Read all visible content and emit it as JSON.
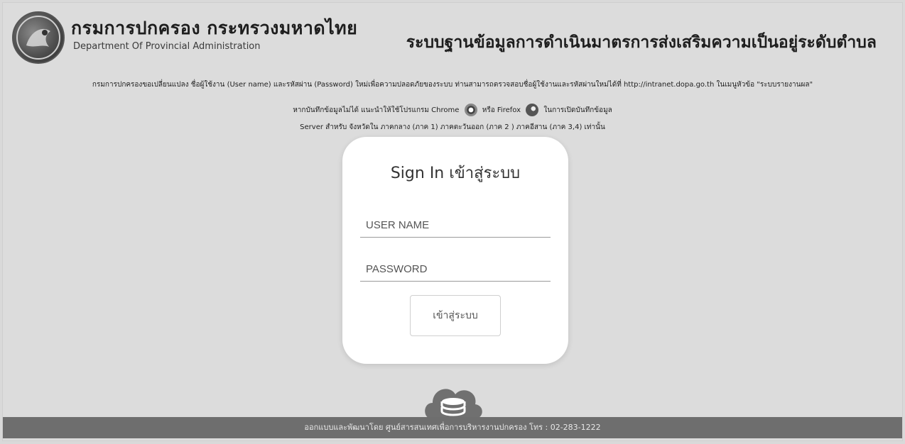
{
  "header": {
    "org_name_th": "กรมการปกครอง กระทรวงมหาดไทย",
    "org_name_en": "Department Of Provincial Administration",
    "system_title": "ระบบฐานข้อมูลการดำเนินมาตรการส่งเสริมความเป็นอยู่ระดับตำบล"
  },
  "notices": {
    "line1": "กรมการปกครองขอเปลี่ยนแปลง ชื่อผู้ใช้งาน (User name) และรหัสผ่าน (Password) ใหม่เพื่อความปลอดภัยของระบบ ท่านสามารถตรวจสอบชื่อผู้ใช้งานและรหัสผ่านใหม่ได้ที่ http://intranet.dopa.go.th ในเมนูหัวข้อ \"ระบบรายงานผล\"",
    "line2_a": "หากบันทึกข้อมูลไม่ได้ แนะนำให้ใช้โปรแกรม Chrome",
    "line2_b": "หรือ Firefox",
    "line2_c": "ในการเปิดบันทึกข้อมูล",
    "line3": "Server สำหรับ จังหวัดใน ภาคกลาง (ภาค 1) ภาคตะวันออก (ภาค 2 ) ภาคอีสาน (ภาค 3,4) เท่านั้น"
  },
  "login": {
    "title": "Sign In เข้าสู่ระบบ",
    "username_placeholder": "USER NAME",
    "password_placeholder": "PASSWORD",
    "submit_label": "เข้าสู่ระบบ"
  },
  "footer": {
    "text": "ออกแบบและพัฒนาโดย ศูนย์สารสนเทศเพื่อการบริหารงานปกครอง โทร : 02-283-1222"
  },
  "icons": {
    "logo": "department-seal-icon",
    "chrome": "chrome-icon",
    "firefox": "firefox-icon",
    "cloud": "cloud-database-icon"
  }
}
